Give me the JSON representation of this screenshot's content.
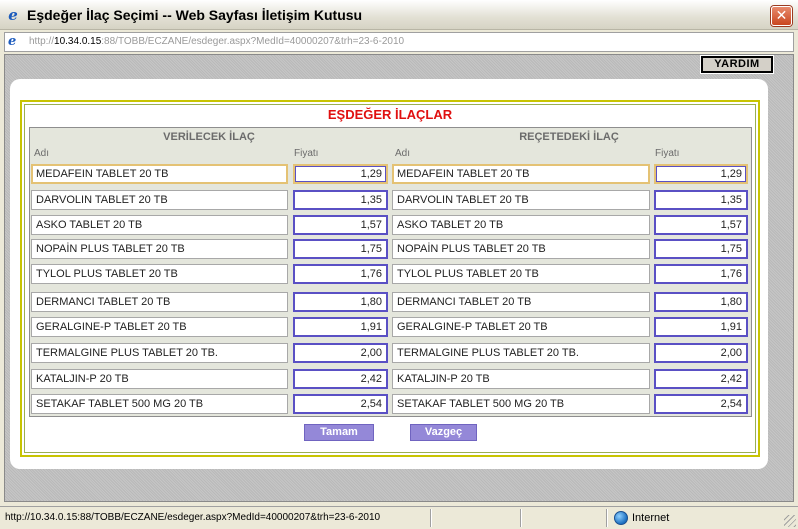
{
  "window": {
    "title": "Eşdeğer İlaç Seçimi -- Web Sayfası İletişim Kutusu",
    "close_glyph": "✕"
  },
  "address": {
    "prefix": "http://",
    "host": "10.34.0.15",
    "rest": ":88/TOBB/ECZANE/esdeger.aspx?MedId=40000207&trh=23-6-2010"
  },
  "toolbar": {
    "help_label": "YARDIM"
  },
  "page": {
    "title": "EŞDEĞER İLAÇLAR",
    "left_header": "VERİLECEK İLAÇ",
    "right_header": "REÇETEDEKİ İLAÇ",
    "name_label": "Adı",
    "price_label": "Fiyatı"
  },
  "rows": [
    {
      "left_name": "MEDAFEIN TABLET 20 TB",
      "left_price": "1,29",
      "right_name": "MEDAFEIN TABLET 20 TB",
      "right_price": "1,29"
    },
    {
      "left_name": "DARVOLIN TABLET 20 TB",
      "left_price": "1,35",
      "right_name": "DARVOLIN TABLET 20 TB",
      "right_price": "1,35"
    },
    {
      "left_name": "ASKO TABLET 20 TB",
      "left_price": "1,57",
      "right_name": "ASKO TABLET 20 TB",
      "right_price": "1,57"
    },
    {
      "left_name": "NOPAİN PLUS TABLET 20 TB",
      "left_price": "1,75",
      "right_name": "NOPAİN PLUS TABLET 20 TB",
      "right_price": "1,75"
    },
    {
      "left_name": "TYLOL PLUS TABLET 20 TB",
      "left_price": "1,76",
      "right_name": "TYLOL PLUS TABLET 20 TB",
      "right_price": "1,76"
    },
    {
      "left_name": "DERMANCI TABLET 20 TB",
      "left_price": "1,80",
      "right_name": "DERMANCI TABLET 20 TB",
      "right_price": "1,80"
    },
    {
      "left_name": "GERALGINE-P TABLET 20 TB",
      "left_price": "1,91",
      "right_name": "GERALGINE-P TABLET 20 TB",
      "right_price": "1,91"
    },
    {
      "left_name": "TERMALGINE PLUS TABLET 20 TB.",
      "left_price": "2,00",
      "right_name": "TERMALGINE PLUS TABLET 20 TB.",
      "right_price": "2,00"
    },
    {
      "left_name": "KATALJIN-P 20 TB",
      "left_price": "2,42",
      "right_name": "KATALJIN-P 20 TB",
      "right_price": "2,42"
    },
    {
      "left_name": "SETAKAF TABLET 500 MG 20 TB",
      "left_price": "2,54",
      "right_name": "SETAKAF TABLET 500 MG 20 TB",
      "right_price": "2,54"
    }
  ],
  "actions": {
    "ok_label": "Tamam",
    "cancel_label": "Vazgeç"
  },
  "status": {
    "url": "http://10.34.0.15:88/TOBB/ECZANE/esdeger.aspx?MedId=40000207&trh=23-6-2010",
    "zone": "Internet"
  }
}
